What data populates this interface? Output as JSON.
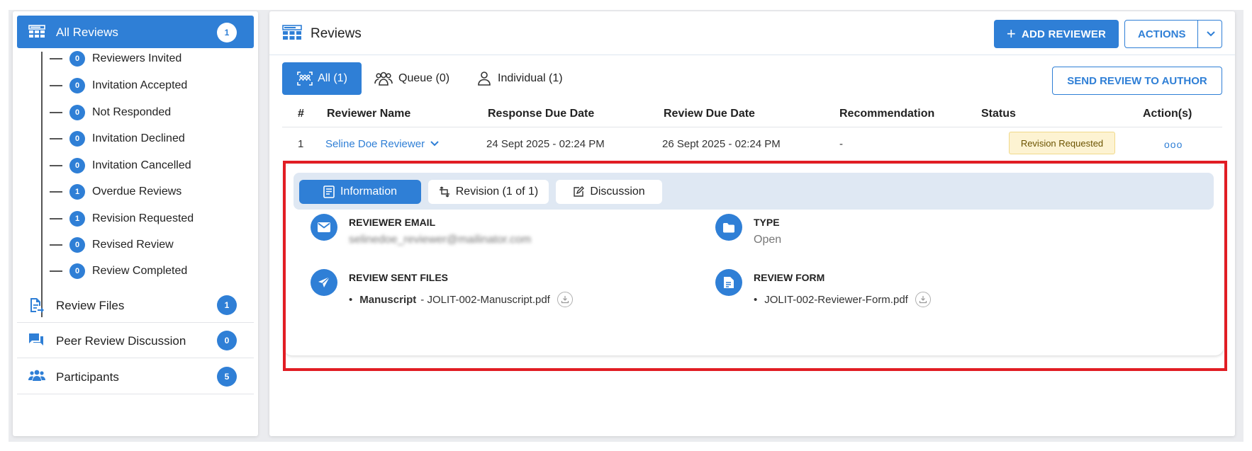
{
  "sidebar": {
    "active": {
      "label": "All Reviews",
      "count": "1"
    },
    "sub_items": [
      {
        "count": "0",
        "label": "Reviewers Invited"
      },
      {
        "count": "0",
        "label": "Invitation Accepted"
      },
      {
        "count": "0",
        "label": "Not Responded"
      },
      {
        "count": "0",
        "label": "Invitation Declined"
      },
      {
        "count": "0",
        "label": "Invitation Cancelled"
      },
      {
        "count": "1",
        "label": "Overdue Reviews"
      },
      {
        "count": "1",
        "label": "Revision Requested"
      },
      {
        "count": "0",
        "label": "Revised Review"
      },
      {
        "count": "0",
        "label": "Review Completed"
      }
    ],
    "sections": [
      {
        "label": "Review Files",
        "count": "1",
        "icon": "file-arrow-icon"
      },
      {
        "label": "Peer Review Discussion",
        "count": "0",
        "icon": "chat-icon"
      },
      {
        "label": "Participants",
        "count": "5",
        "icon": "people-icon"
      }
    ]
  },
  "header": {
    "title": "Reviews",
    "add_reviewer": "ADD REVIEWER",
    "add_icon": "+",
    "actions": "ACTIONS"
  },
  "tabs": {
    "all": "All (1)",
    "queue": "Queue (0)",
    "individual": "Individual (1)"
  },
  "send_review_button": "SEND REVIEW TO AUTHOR",
  "table": {
    "headers": [
      "#",
      "Reviewer Name",
      "Response Due Date",
      "Review Due Date",
      "Recommendation",
      "Status",
      "Action(s)"
    ],
    "row": {
      "num": "1",
      "reviewer": "Seline Doe Reviewer",
      "response_due": "24 Sept 2025 - 02:24 PM",
      "review_due": "26 Sept 2025 - 02:24 PM",
      "recommendation": "-",
      "status": "Revision Requested",
      "actions": "ooo"
    }
  },
  "detail": {
    "tabs": {
      "information": "Information",
      "revision": "Revision (1 of 1)",
      "discussion": "Discussion"
    },
    "reviewer_email": {
      "title": "REVIEWER EMAIL",
      "value": "selinedoe_reviewer@mailinator.com"
    },
    "type": {
      "title": "TYPE",
      "value": "Open"
    },
    "sent_files": {
      "title": "REVIEW SENT FILES",
      "bullet": "•",
      "label": "Manuscript",
      "file": "- JOLIT-002-Manuscript.pdf"
    },
    "review_form": {
      "title": "REVIEW FORM",
      "bullet": "•",
      "file": "JOLIT-002-Reviewer-Form.pdf"
    }
  },
  "colors": {
    "accent": "#2f7fd6",
    "highlight_border": "#e11d24",
    "status_bg": "#fdf3d2"
  }
}
